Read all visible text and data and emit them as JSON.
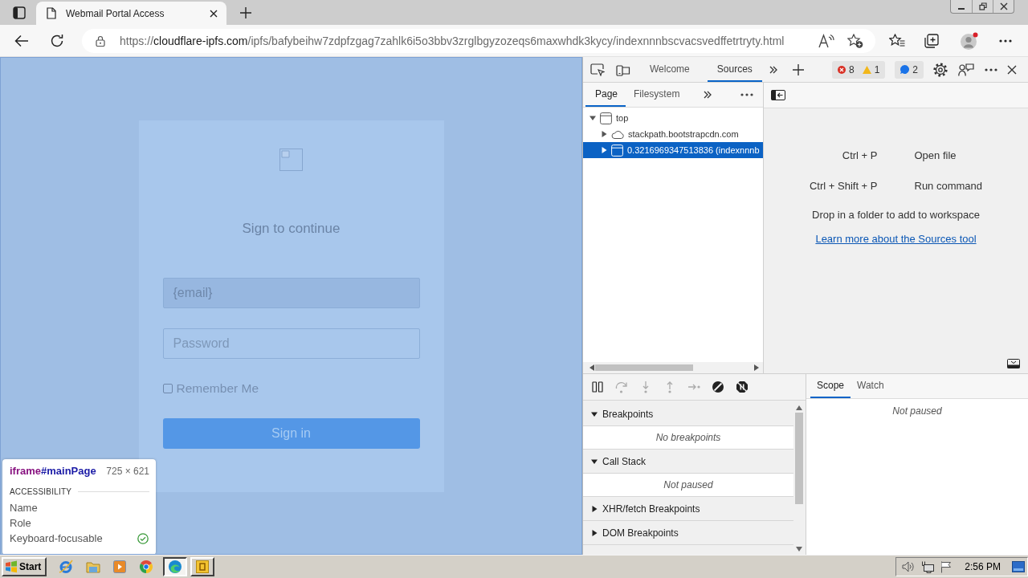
{
  "browser": {
    "tabs": [
      {
        "title": "Webmail Portal Access",
        "selected": true
      }
    ],
    "address_bar": {
      "scheme": "https://",
      "host": "cloudflare-ipfs.com",
      "path": "/ipfs/bafybeihw7zdpfzgag7zahlk6i5o3bbv3zrglbgyzozeqs6maxwhdk3kycy/indexnnnbscvacsvedffetrtryty.html"
    }
  },
  "page": {
    "login_card": {
      "heading": "Sign to continue",
      "email_field": {
        "value": "{email}"
      },
      "password_field": {
        "placeholder": "Password"
      },
      "remember_me": {
        "label": "Remember Me",
        "checked": false
      },
      "sign_in_button": {
        "label": "Sign in"
      }
    },
    "element_tooltip": {
      "tag": "iframe",
      "id": "#mainPage",
      "size": "725 × 621",
      "section": "ACCESSIBILITY",
      "properties": [
        {
          "label": "Name"
        },
        {
          "label": "Role"
        }
      ],
      "keyboard_focusable": {
        "label": "Keyboard-focusable",
        "on": true
      }
    }
  },
  "devtools": {
    "tabs": [
      {
        "label": "Welcome",
        "selected": false
      },
      {
        "label": "Sources",
        "selected": true
      }
    ],
    "issues": {
      "errors": "8",
      "warnings": "1",
      "info": "2"
    },
    "navigator": {
      "tabs": [
        {
          "label": "Page",
          "selected": true
        },
        {
          "label": "Filesystem",
          "selected": false
        }
      ],
      "tree": [
        {
          "label": "top",
          "kind": "frame",
          "expanded": true,
          "selected": false,
          "children": [
            {
              "label": "stackpath.bootstrapcdn.com",
              "kind": "domain",
              "expanded": false,
              "selected": false
            },
            {
              "label": "0.3216969347513836 (indexnnnb",
              "kind": "frame",
              "expanded": false,
              "selected": true
            }
          ]
        }
      ]
    },
    "editor": {
      "shortcuts": [
        {
          "keys": "Ctrl + P",
          "action": "Open file"
        },
        {
          "keys": "Ctrl + Shift + P",
          "action": "Run command"
        }
      ],
      "drop_hint": "Drop in a folder to add to workspace",
      "learn_more_link": "Learn more about the Sources tool"
    },
    "debugger": {
      "controls": [
        {
          "kind": "pause",
          "disabled": false
        },
        {
          "kind": "stepover",
          "disabled": true
        },
        {
          "kind": "stepinto",
          "disabled": true
        },
        {
          "kind": "stepout",
          "disabled": true
        },
        {
          "kind": "step",
          "disabled": true
        },
        {
          "kind": "deactivate",
          "disabled": false
        },
        {
          "kind": "exceptions",
          "disabled": false
        }
      ],
      "sections": [
        {
          "title": "Breakpoints",
          "expanded": true,
          "message": "No breakpoints"
        },
        {
          "title": "Call Stack",
          "expanded": true,
          "message": "Not paused"
        },
        {
          "title": "XHR/fetch Breakpoints",
          "expanded": false
        },
        {
          "title": "DOM Breakpoints",
          "expanded": false
        }
      ]
    },
    "sidebar": {
      "tabs": [
        {
          "label": "Scope",
          "selected": true
        },
        {
          "label": "Watch",
          "selected": false
        }
      ],
      "message": "Not paused"
    }
  },
  "taskbar": {
    "start_button": "Start",
    "quick_launch": [
      {
        "kind": "globe"
      },
      {
        "kind": "folder"
      },
      {
        "kind": "player"
      },
      {
        "kind": "orb"
      }
    ],
    "windows": [
      {
        "kind": "swirl",
        "selected": true
      },
      {
        "kind": "note",
        "selected": false
      }
    ],
    "clock": "2:56 PM"
  }
}
